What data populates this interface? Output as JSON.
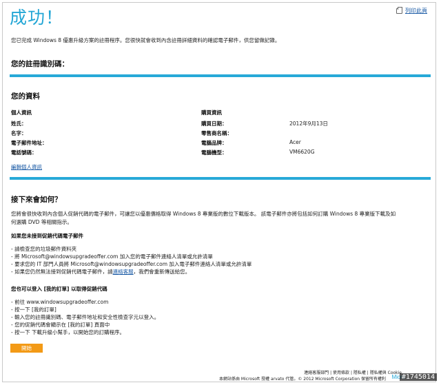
{
  "header": {
    "title": "成功！",
    "print_label": "列印此頁"
  },
  "intro": "您已完成 Windows 8 優惠升級方案的註冊程序。您很快就會收到內含註冊詳細資料的確認電子郵件，供您留做記錄。",
  "registration": {
    "heading": "您的註冊識別碼："
  },
  "your_info": {
    "heading": "您的資料",
    "personal": {
      "heading": "個人資訊",
      "last_name": "姓氏：",
      "first_name": "名字：",
      "email": "電子郵件地址：",
      "phone": "電話號碼："
    },
    "purchase": {
      "heading": "購買資訊",
      "date_label": "購買日期：",
      "date_value": "2012年9月13日",
      "retailer_label": "零售商名稱：",
      "brand_label": "電腦品牌：",
      "brand_value": "Acer",
      "model_label": "電腦機型：",
      "model_value": "VM6620G"
    },
    "edit_link": "編輯個人資訊"
  },
  "next": {
    "heading": "接下來會如何？",
    "body_line1": "您將會很快收到內含個人促銷代碼的電子郵件，可讓您以優惠價格取得 Windows 8 專業版的數位下載版本。 該電子郵件亦將包括如何訂購 Windows 8 專業版下載及如",
    "body_line2": "何選購 DVD 等相關指示。",
    "no_email_heading": "如果您未接到促銷代碼電子郵件",
    "no_email_items": [
      "請檢查您的垃圾郵件資料夾",
      "將 Microsoft@windowsupgradeoffer.com 加入您的電子郵件連絡人清單或允許清單",
      "要求您的 IT 部門人員將 Microsoft@windowsupgradeoffer.com 加入電子郵件連絡人清單或允許清單",
      "如果您仍然無法接到促銷代碼電子郵件，請"
    ],
    "support_link": "連絡客服",
    "support_suffix": "，我們會重新傳送給您。",
    "login_heading": "您也可以登入 [我的訂單] 以取得促銷代碼",
    "login_items": [
      "前往 www.windowsupgradeoffer.com",
      "按一下 [我的訂單]",
      "輸入您的註冊識別碼、電子郵件地址和安全性檢查字元以登入。",
      "您的促銷代碼會顯示在 [我的訂單] 頁面中",
      "按一下 下載升級小幫手，以開始您的訂購程序。"
    ],
    "start_button": "開始"
  },
  "footer": {
    "links": "連絡客服部門 | 使用條款 | 隱私權 | 隱私權與 Cookie",
    "copyright": "本網站係由 Microsoft 授權 arvato 代管。© 2012 Microsoft Corporation 保留所有權利",
    "logo": "Micro",
    "watermark": "#1745014"
  },
  "colors": {
    "accent": "#27a9d8",
    "button": "#f39a16",
    "link": "#1a5aa5"
  }
}
